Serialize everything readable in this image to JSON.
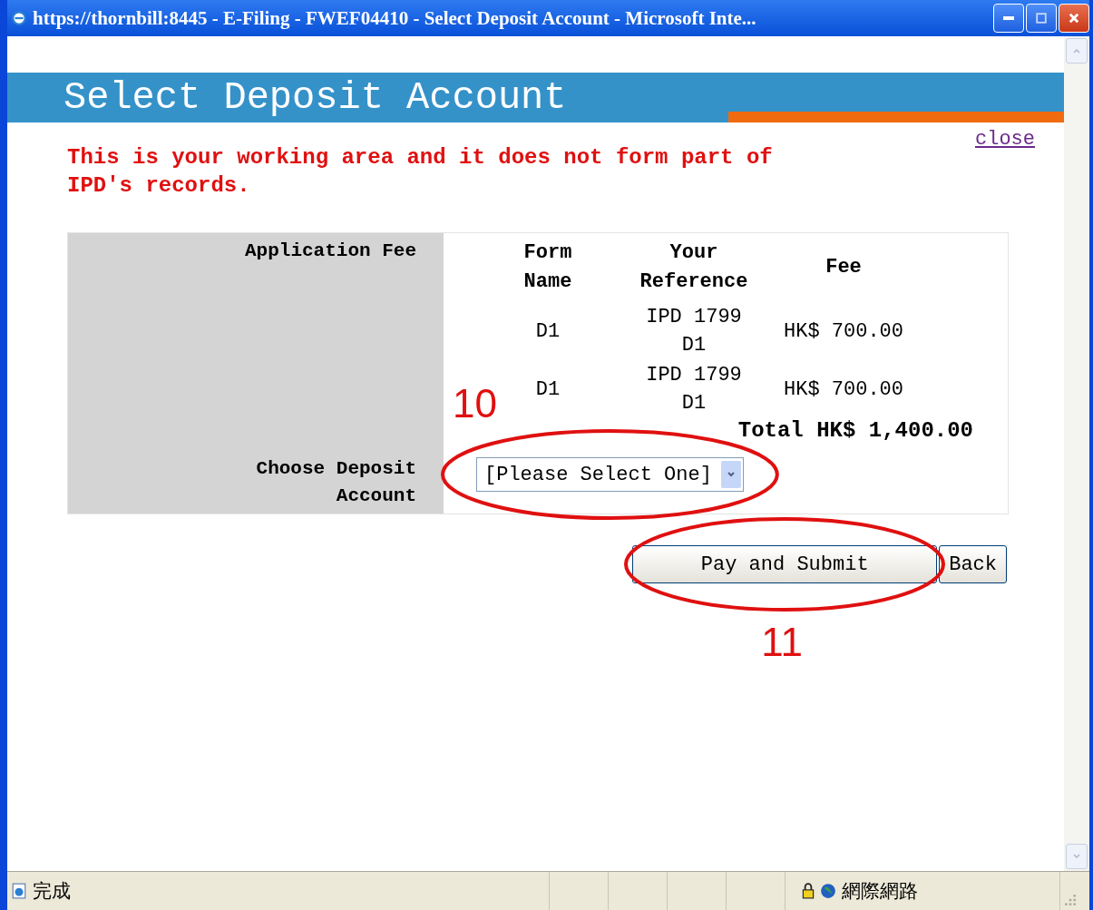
{
  "window": {
    "title": "https://thornbill:8445 - E-Filing - FWEF04410 - Select Deposit Account - Microsoft Inte..."
  },
  "page": {
    "heading": "Select Deposit Account",
    "close_link": "close",
    "warning": "This is your working area and it does not form part of IPD's records."
  },
  "fee_table": {
    "label": "Application Fee",
    "columns": [
      "Form Name",
      "Your Reference",
      "Fee"
    ],
    "rows": [
      {
        "form_name": "D1",
        "reference": "IPD 1799 D1",
        "fee": "HK$ 700.00"
      },
      {
        "form_name": "D1",
        "reference": "IPD 1799 D1",
        "fee": "HK$ 700.00"
      }
    ],
    "total": "Total HK$ 1,400.00"
  },
  "deposit": {
    "label": "Choose Deposit Account",
    "value": "[Please Select One]"
  },
  "buttons": [
    "Pay and Submit",
    "Back"
  ],
  "annotations": [
    {
      "number": "10"
    },
    {
      "number": "11"
    }
  ],
  "status_bar": {
    "text": "完成",
    "zone": "網際網路"
  }
}
